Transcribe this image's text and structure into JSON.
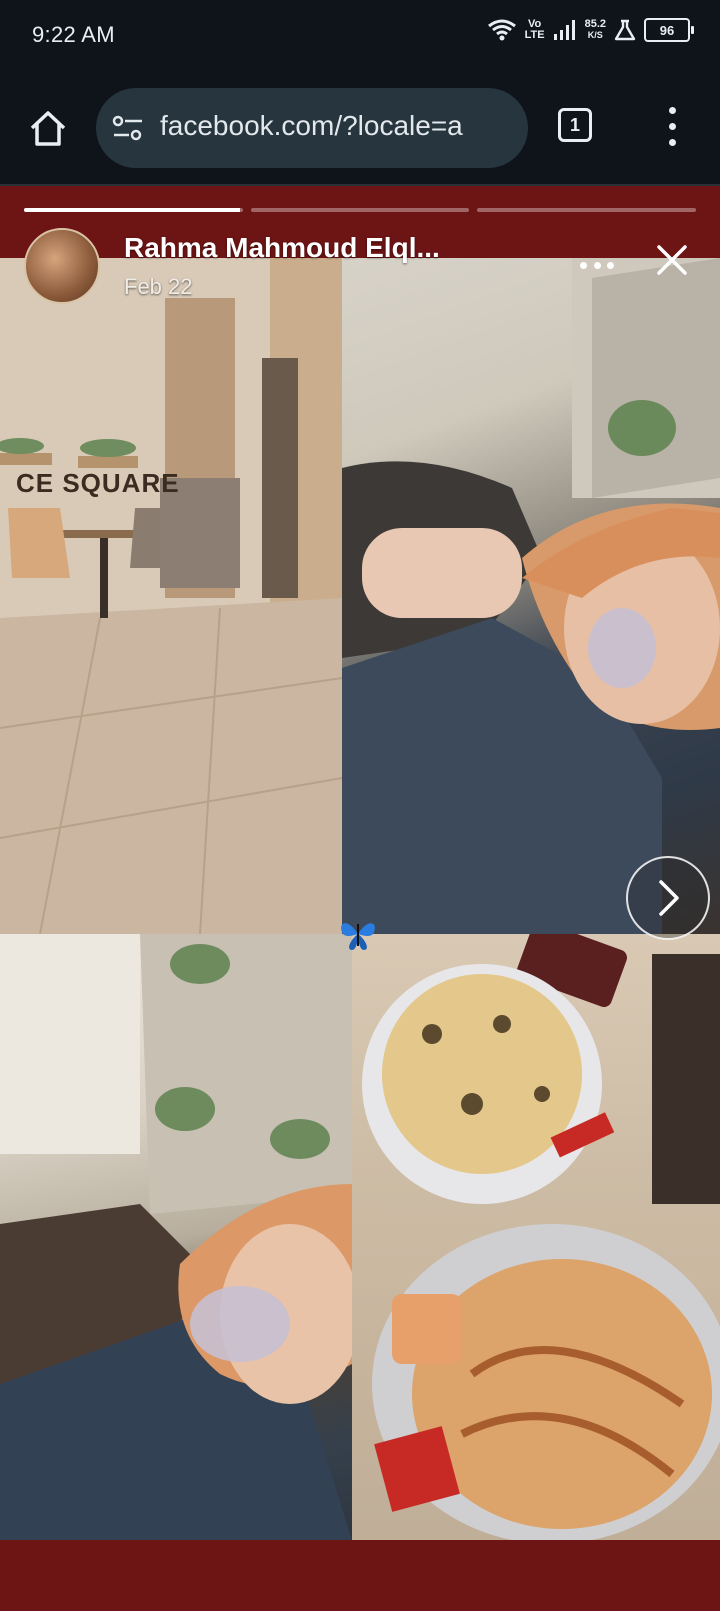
{
  "status_bar": {
    "time": "9:22 AM",
    "signal_top": "Vo",
    "signal_bottom": "LTE",
    "speed_value": "85.2",
    "speed_unit": "K/S",
    "battery": "96"
  },
  "browser": {
    "url": "facebook.com/?locale=a",
    "tab_count": "1"
  },
  "story": {
    "author_name": "Rahma Mahmoud Elql...",
    "date": "Feb 22",
    "progress_segments": [
      1,
      0,
      0
    ],
    "progress_current_fraction": 0.33,
    "photo_sign_text": "CE SQUARE",
    "sticker_icon": "butterfly-emoji",
    "colors": {
      "background": "#6d1414",
      "browser_bar": "#0f141a",
      "url_box": "#27353f"
    }
  }
}
